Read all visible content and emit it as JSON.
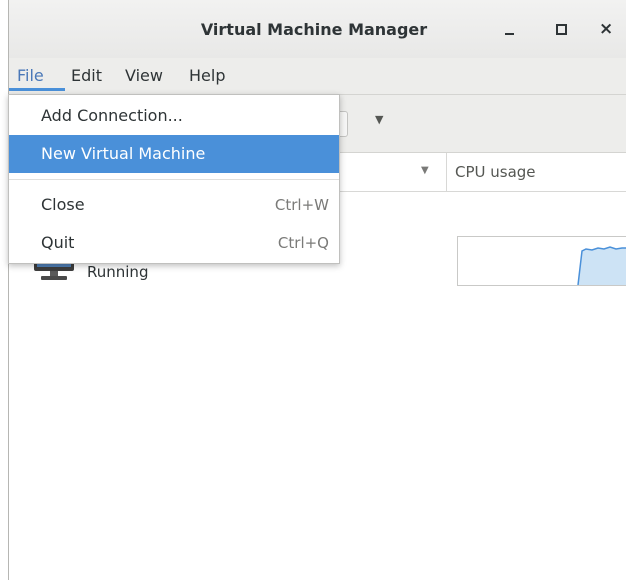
{
  "window": {
    "title": "Virtual Machine Manager",
    "controls": {
      "minimize": "_",
      "maximize": "□",
      "close": "×"
    }
  },
  "menubar": {
    "items": [
      {
        "label": "File",
        "active": true
      },
      {
        "label": "Edit"
      },
      {
        "label": "View"
      },
      {
        "label": "Help"
      }
    ]
  },
  "file_menu": {
    "items": [
      {
        "label": "Add Connection...",
        "accel": ""
      },
      {
        "label": "New Virtual Machine",
        "accel": "",
        "highlighted": true
      },
      {
        "label": "Close",
        "accel": "Ctrl+W"
      },
      {
        "label": "Quit",
        "accel": "Ctrl+Q"
      }
    ]
  },
  "list": {
    "columns": {
      "cpu": "CPU usage"
    },
    "rows": [
      {
        "status": "Running",
        "icon": "monitor-icon"
      }
    ]
  },
  "colors": {
    "highlight": "#4a90d9",
    "graph_fill": "#cde3f5",
    "graph_line": "#4a90d9"
  }
}
